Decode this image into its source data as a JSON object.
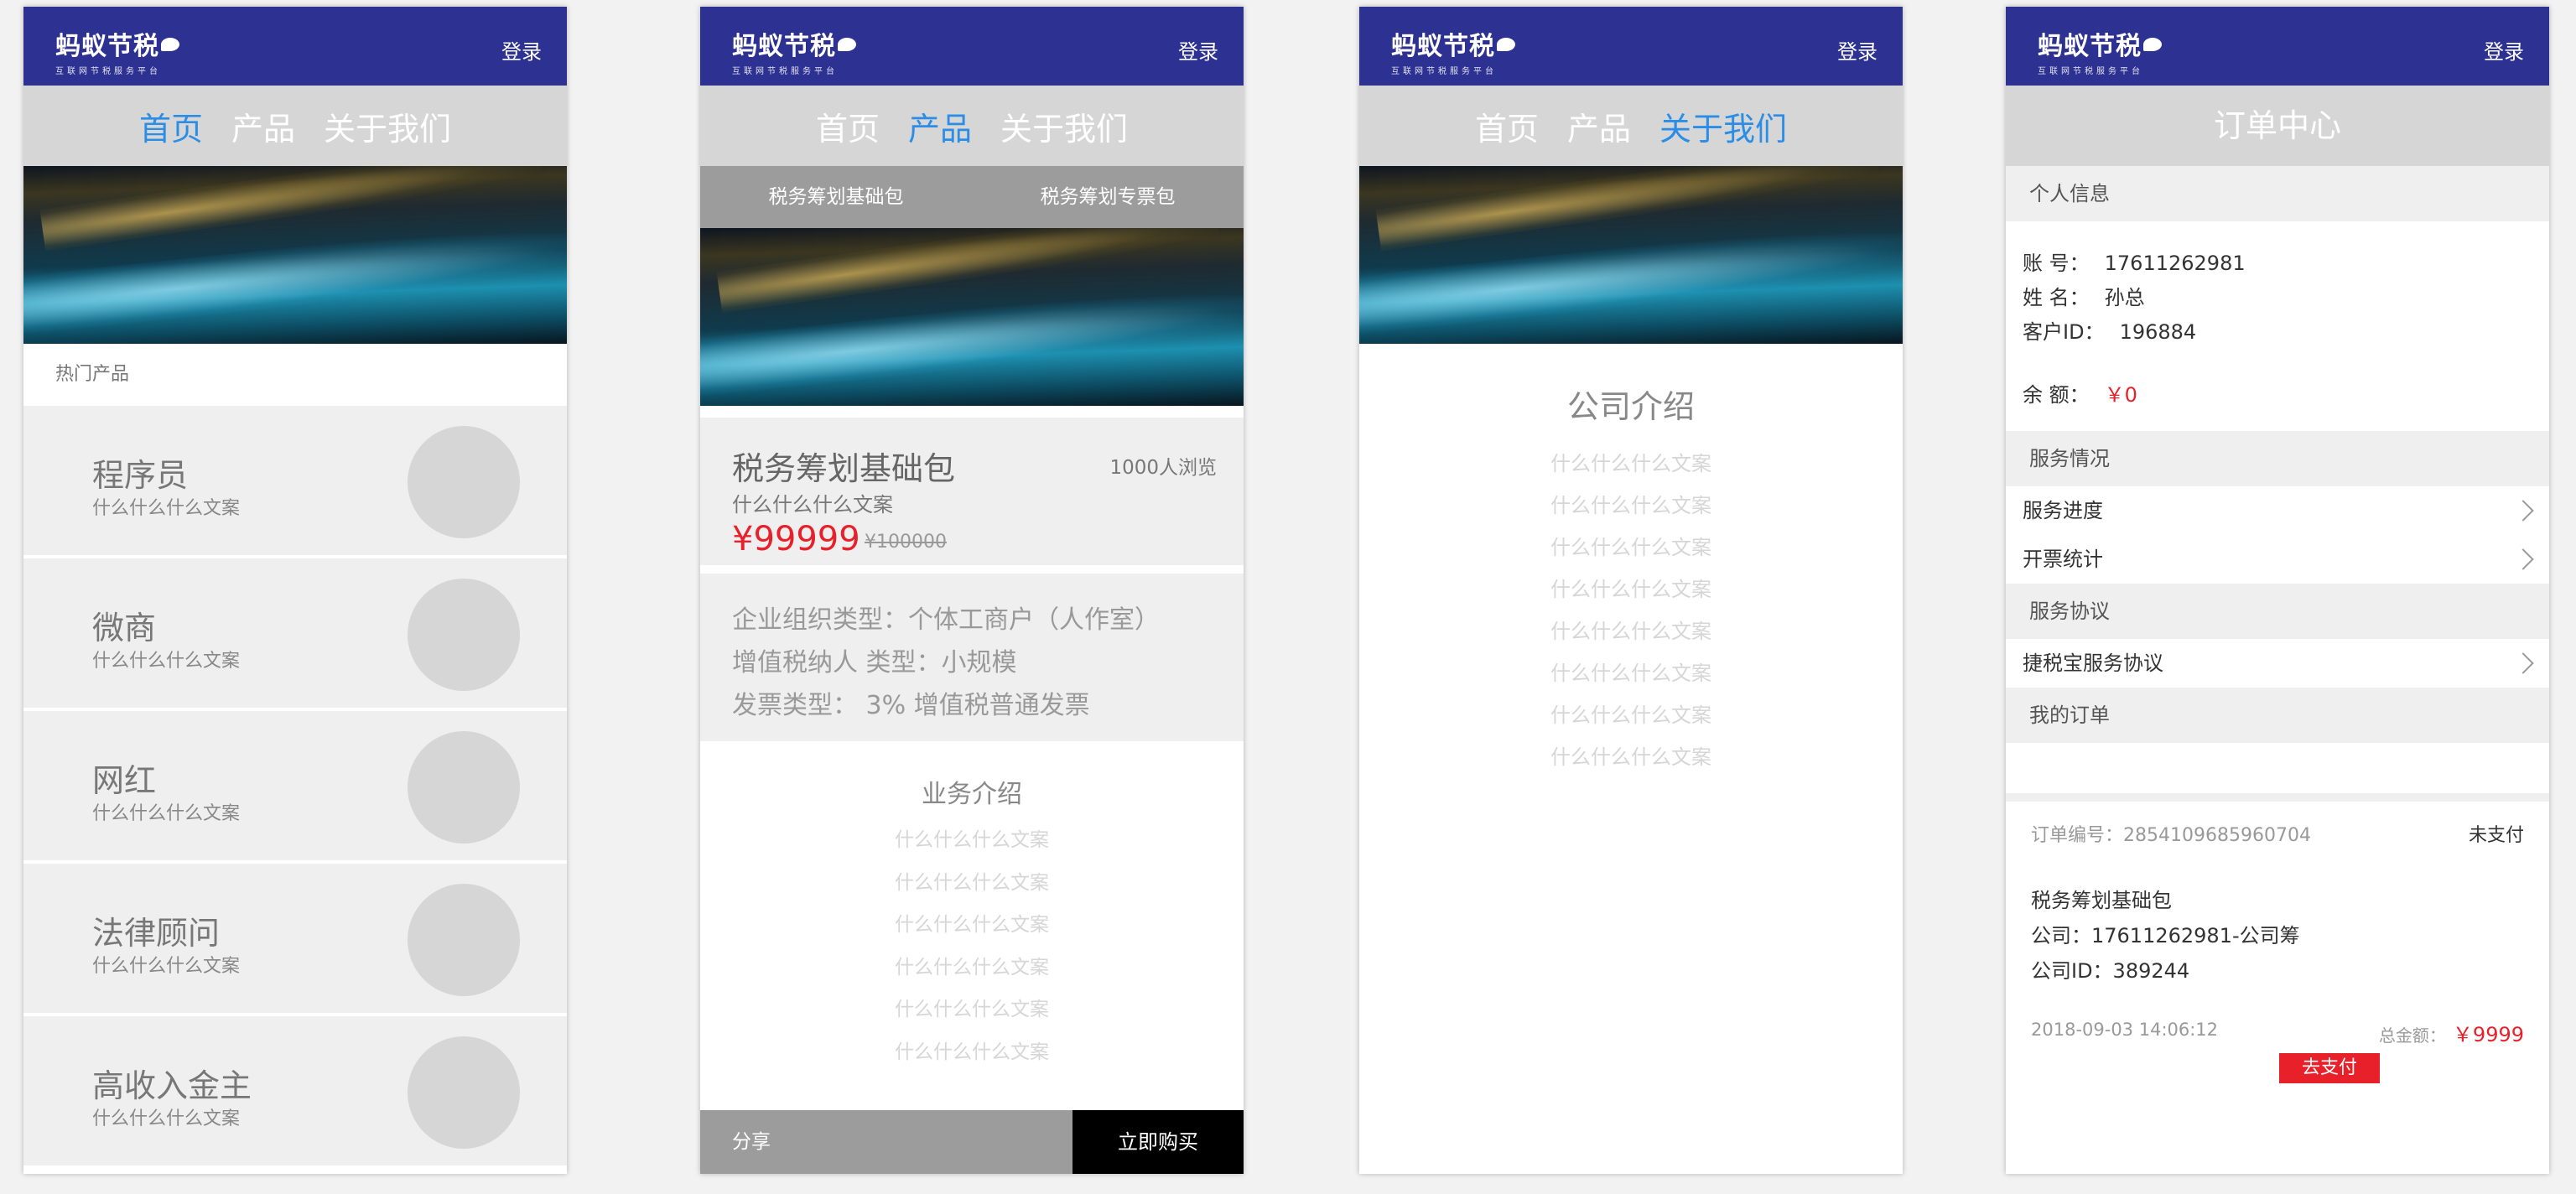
{
  "header": {
    "logo": "蚂蚁节税",
    "slogan": "互联网节税服务平台",
    "login": "登录"
  },
  "nav": {
    "home": "首页",
    "product": "产品",
    "about": "关于我们"
  },
  "screen1": {
    "hot_label": "热门产品",
    "cards": [
      {
        "title": "程序员",
        "sub": "什么什么什么文案"
      },
      {
        "title": "微商",
        "sub": "什么什么什么文案"
      },
      {
        "title": "网红",
        "sub": "什么什么什么文案"
      },
      {
        "title": "法律顾问",
        "sub": "什么什么什么文案"
      },
      {
        "title": "高收入金主",
        "sub": "什么什么什么文案"
      }
    ]
  },
  "screen2": {
    "tabs": [
      "税务筹划基础包",
      "税务筹划专票包"
    ],
    "product": {
      "name": "税务筹划基础包",
      "views": "1000人浏览",
      "desc": "什么什么什么文案",
      "price": "¥99999",
      "orig_price": "¥100000"
    },
    "attrs": [
      "企业组织类型：个体工商户（人作室）",
      "增值税纳人 类型：小规模",
      "发票类型：  3% 增值税普通发票"
    ],
    "biz_title": "业务介绍",
    "biz_lines": [
      "什么什么什么文案",
      "什么什么什么文案",
      "什么什么什么文案",
      "什么什么什么文案",
      "什么什么什么文案",
      "什么什么什么文案"
    ],
    "share": "分享",
    "buy": "立即购买"
  },
  "screen3": {
    "title": "公司介绍",
    "lines": [
      "什么什么什么文案",
      "什么什么什么文案",
      "什么什么什么文案",
      "什么什么什么文案",
      "什么什么什么文案",
      "什么什么什么文案",
      "什么什么什么文案",
      "什么什么什么文案"
    ]
  },
  "screen4": {
    "title": "订单中心",
    "personal": "个人信息",
    "account_label": "账  号：",
    "account": "17611262981",
    "name_label": "姓  名：",
    "name": "孙总",
    "cid_label": "客户ID：",
    "cid": "196884",
    "balance_label": "余  额：",
    "balance": "￥0",
    "service": "服务情况",
    "progress": "服务进度",
    "invoice": "开票统计",
    "agreement_sec": "服务协议",
    "agreement": "捷税宝服务协议",
    "my_orders": "我的订单",
    "order": {
      "no": "订单编号：2854109685960704",
      "status": "未支付",
      "product": "税务筹划基础包",
      "company": "公司：17611262981-公司筹",
      "company_id": "公司ID：389244",
      "time": "2018-09-03 14:06:12",
      "total_label": "总金额：",
      "total": "￥9999",
      "pay": "去支付"
    }
  }
}
